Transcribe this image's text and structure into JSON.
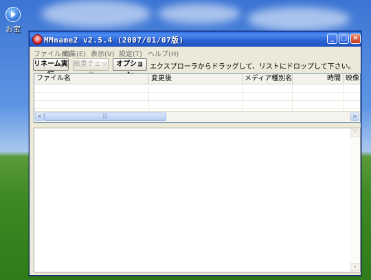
{
  "desktop": {
    "icon_label": "お宝"
  },
  "window": {
    "title": "MMname2 v2.5.4 (2007/01/07版)",
    "buttons": {
      "minimize": "_",
      "maximize": "□",
      "close": "×"
    }
  },
  "menu": {
    "items": [
      {
        "label": "ファイル(F)"
      },
      {
        "label": "編集(E)"
      },
      {
        "label": "表示(V)"
      },
      {
        "label": "設定(T)"
      },
      {
        "label": "ヘルプ(H)"
      }
    ]
  },
  "toolbar": {
    "rename_label": "リネーム実行",
    "dupcheck_label": "厳重チェック",
    "options_label": "オプション",
    "hint": "エクスプローラからドラッグして、リストにドロップして下さい。"
  },
  "table": {
    "columns": [
      {
        "label": "ファイル名"
      },
      {
        "label": "変更後"
      },
      {
        "label": "メディア種別名"
      },
      {
        "label": "時間"
      },
      {
        "label": "映像コ"
      }
    ],
    "rows": []
  },
  "scrollbar": {
    "left_arrow": "<",
    "right_arrow": ">",
    "up_arrow": "^",
    "down_arrow": "v"
  },
  "colors": {
    "title_bar": "#2a63d6",
    "window_bg": "#ece9d8",
    "close_button": "#c3391a"
  }
}
